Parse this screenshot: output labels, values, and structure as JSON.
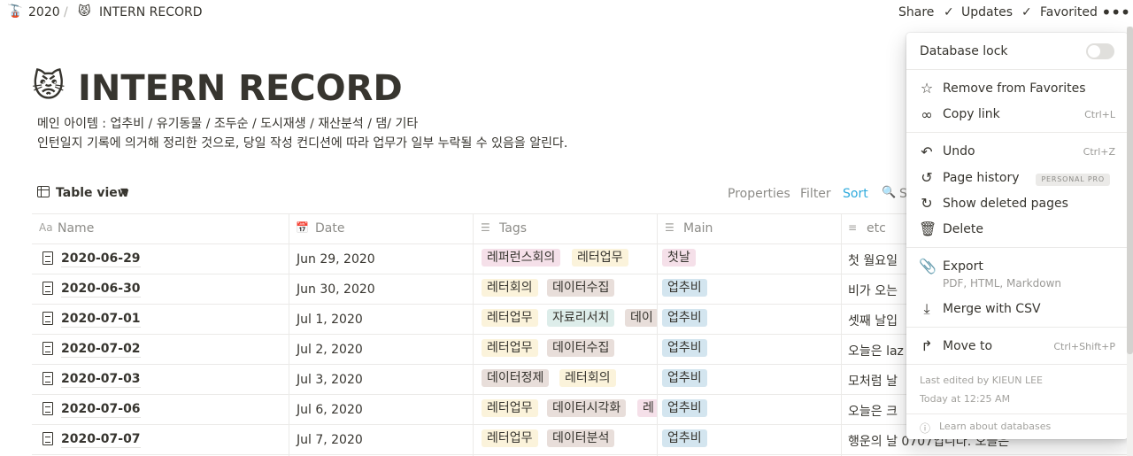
{
  "breadcrumb": {
    "items": [
      {
        "icon": "🚡",
        "label": "2020"
      },
      {
        "icon": "😾",
        "label": "INTERN RECORD"
      }
    ],
    "separator": "/"
  },
  "topbar": {
    "share": "Share",
    "updates": "Updates",
    "favorited": "Favorited",
    "more": "•••"
  },
  "page": {
    "emoji": "😾",
    "title": "INTERN RECORD",
    "description": [
      "메인 아이템 : 업추비 / 유기동물 / 조두순 / 도시재생 / 재산분석 / 댐/ 기타",
      "인턴일지 기록에 의거해 정리한 것으로, 당일 작성 컨디션에 따라 업무가 일부 누락될 수 있음을 알린다."
    ]
  },
  "view": {
    "label": "Table view",
    "properties": "Properties",
    "filter": "Filter",
    "sort": "Sort",
    "search": "S"
  },
  "table": {
    "columns": [
      {
        "icon": "Aa",
        "label": "Name"
      },
      {
        "icon": "📅",
        "label": "Date"
      },
      {
        "icon": "☰",
        "label": "Tags"
      },
      {
        "icon": "☰",
        "label": "Main"
      },
      {
        "icon": "≡",
        "label": "etc"
      }
    ],
    "rows": [
      {
        "name": "2020-06-29",
        "date": "Jun 29, 2020",
        "tags": [
          {
            "label": "레퍼런스회의",
            "color": "#f5e0e9"
          },
          {
            "label": "레터업무",
            "color": "#fbf3db"
          }
        ],
        "main": {
          "label": "첫날",
          "color": "#f5e0e9"
        },
        "etc": "첫 월요일"
      },
      {
        "name": "2020-06-30",
        "date": "Jun 30, 2020",
        "tags": [
          {
            "label": "레터회의",
            "color": "#fbf3db"
          },
          {
            "label": "데이터수집",
            "color": "#e8deda"
          }
        ],
        "main": {
          "label": "업추비",
          "color": "#d3e5ef"
        },
        "etc": "비가 오는"
      },
      {
        "name": "2020-07-01",
        "date": "Jul 1, 2020",
        "tags": [
          {
            "label": "레터업무",
            "color": "#fbf3db"
          },
          {
            "label": "자료리서치",
            "color": "#ddedea"
          },
          {
            "label": "데이",
            "color": "#e8deda"
          }
        ],
        "main": {
          "label": "업추비",
          "color": "#d3e5ef"
        },
        "etc": "셋째 날입"
      },
      {
        "name": "2020-07-02",
        "date": "Jul 2, 2020",
        "tags": [
          {
            "label": "레터업무",
            "color": "#fbf3db"
          },
          {
            "label": "데이터수집",
            "color": "#e8deda"
          }
        ],
        "main": {
          "label": "업추비",
          "color": "#d3e5ef"
        },
        "etc": "오늘은 laz"
      },
      {
        "name": "2020-07-03",
        "date": "Jul 3, 2020",
        "tags": [
          {
            "label": "데이터정제",
            "color": "#e8deda"
          },
          {
            "label": "레터회의",
            "color": "#fbf3db"
          }
        ],
        "main": {
          "label": "업추비",
          "color": "#d3e5ef"
        },
        "etc": "모처럼 날"
      },
      {
        "name": "2020-07-06",
        "date": "Jul 6, 2020",
        "tags": [
          {
            "label": "레터업무",
            "color": "#fbf3db"
          },
          {
            "label": "데이터시각화",
            "color": "#e8deda"
          },
          {
            "label": "레",
            "color": "#f5e0e9"
          }
        ],
        "main": {
          "label": "업추비",
          "color": "#d3e5ef"
        },
        "etc": "오늘은 크"
      },
      {
        "name": "2020-07-07",
        "date": "Jul 7, 2020",
        "tags": [
          {
            "label": "레터업무",
            "color": "#fbf3db"
          },
          {
            "label": "데이터분석",
            "color": "#e8deda"
          }
        ],
        "main": {
          "label": "업추비",
          "color": "#d3e5ef"
        },
        "etc": "행운의 날 0707입니다. 오늘은"
      }
    ]
  },
  "menu": {
    "database_lock": "Database lock",
    "remove_favorites": "Remove from Favorites",
    "copy_link": "Copy link",
    "copy_link_shortcut": "Ctrl+L",
    "undo": "Undo",
    "undo_shortcut": "Ctrl+Z",
    "page_history": "Page history",
    "page_history_badge": "PERSONAL PRO",
    "show_deleted": "Show deleted pages",
    "delete": "Delete",
    "export": "Export",
    "export_sub": "PDF, HTML, Markdown",
    "merge_csv": "Merge with CSV",
    "move_to": "Move to",
    "move_to_shortcut": "Ctrl+Shift+P",
    "last_edited": "Last edited by KIEUN LEE",
    "edited_time": "Today at 12:25 AM",
    "learn": "Learn about databases"
  }
}
